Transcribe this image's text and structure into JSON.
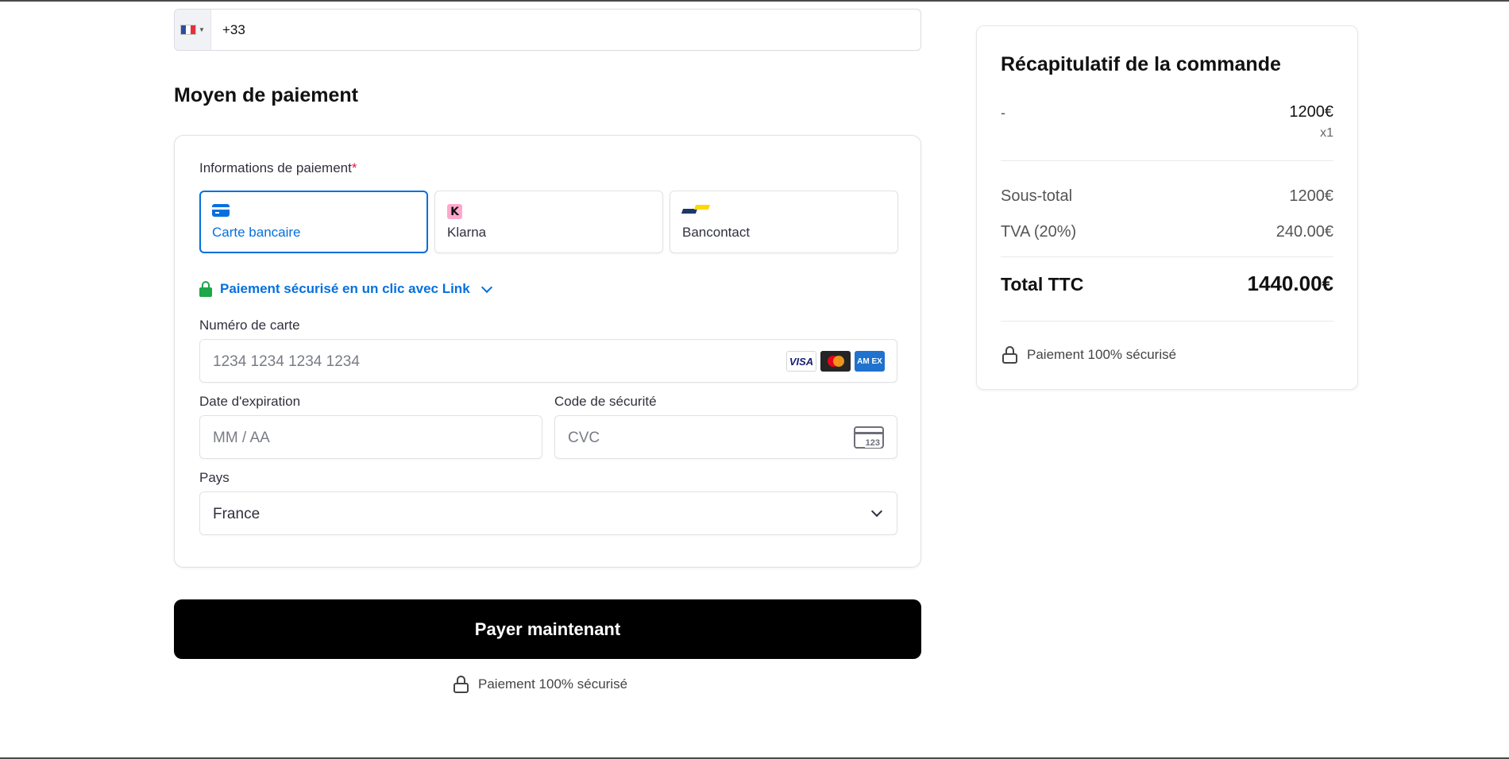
{
  "phone": {
    "flag_icon": "france-flag-icon",
    "country_code": "+33"
  },
  "payment_section": {
    "title": "Moyen de paiement",
    "info_label": "Informations de paiement",
    "required_marker": "*",
    "methods": [
      {
        "label": "Carte bancaire",
        "icon": "credit-card-icon",
        "selected": true
      },
      {
        "label": "Klarna",
        "icon": "klarna-icon",
        "icon_text": "K",
        "selected": false
      },
      {
        "label": "Bancontact",
        "icon": "bancontact-icon",
        "selected": false
      }
    ],
    "link_text": "Paiement sécurisé en un clic avec Link",
    "card_number": {
      "label": "Numéro de carte",
      "placeholder": "1234 1234 1234 1234",
      "brands": [
        "VISA",
        "Mastercard",
        "AM EX"
      ]
    },
    "expiry": {
      "label": "Date d'expiration",
      "placeholder": "MM / AA"
    },
    "cvc": {
      "label": "Code de sécurité",
      "placeholder": "CVC",
      "icon_text": "123"
    },
    "country": {
      "label": "Pays",
      "value": "France"
    }
  },
  "pay_button": {
    "label": "Payer maintenant"
  },
  "secure_note": "Paiement 100% sécurisé",
  "summary": {
    "title": "Récapitulatif de la commande",
    "item": {
      "name": "-",
      "price": "1200€",
      "qty": "x1"
    },
    "subtotal": {
      "label": "Sous-total",
      "value": "1200€"
    },
    "tax": {
      "label": "TVA (20%)",
      "value": "240.00€"
    },
    "total": {
      "label": "Total TTC",
      "value": "1440.00€"
    },
    "secure_note": "Paiement 100% sécurisé"
  },
  "colors": {
    "accent": "#0570de",
    "secure_green": "#1ea64a",
    "button_bg": "#000000",
    "required": "#df1b41"
  }
}
